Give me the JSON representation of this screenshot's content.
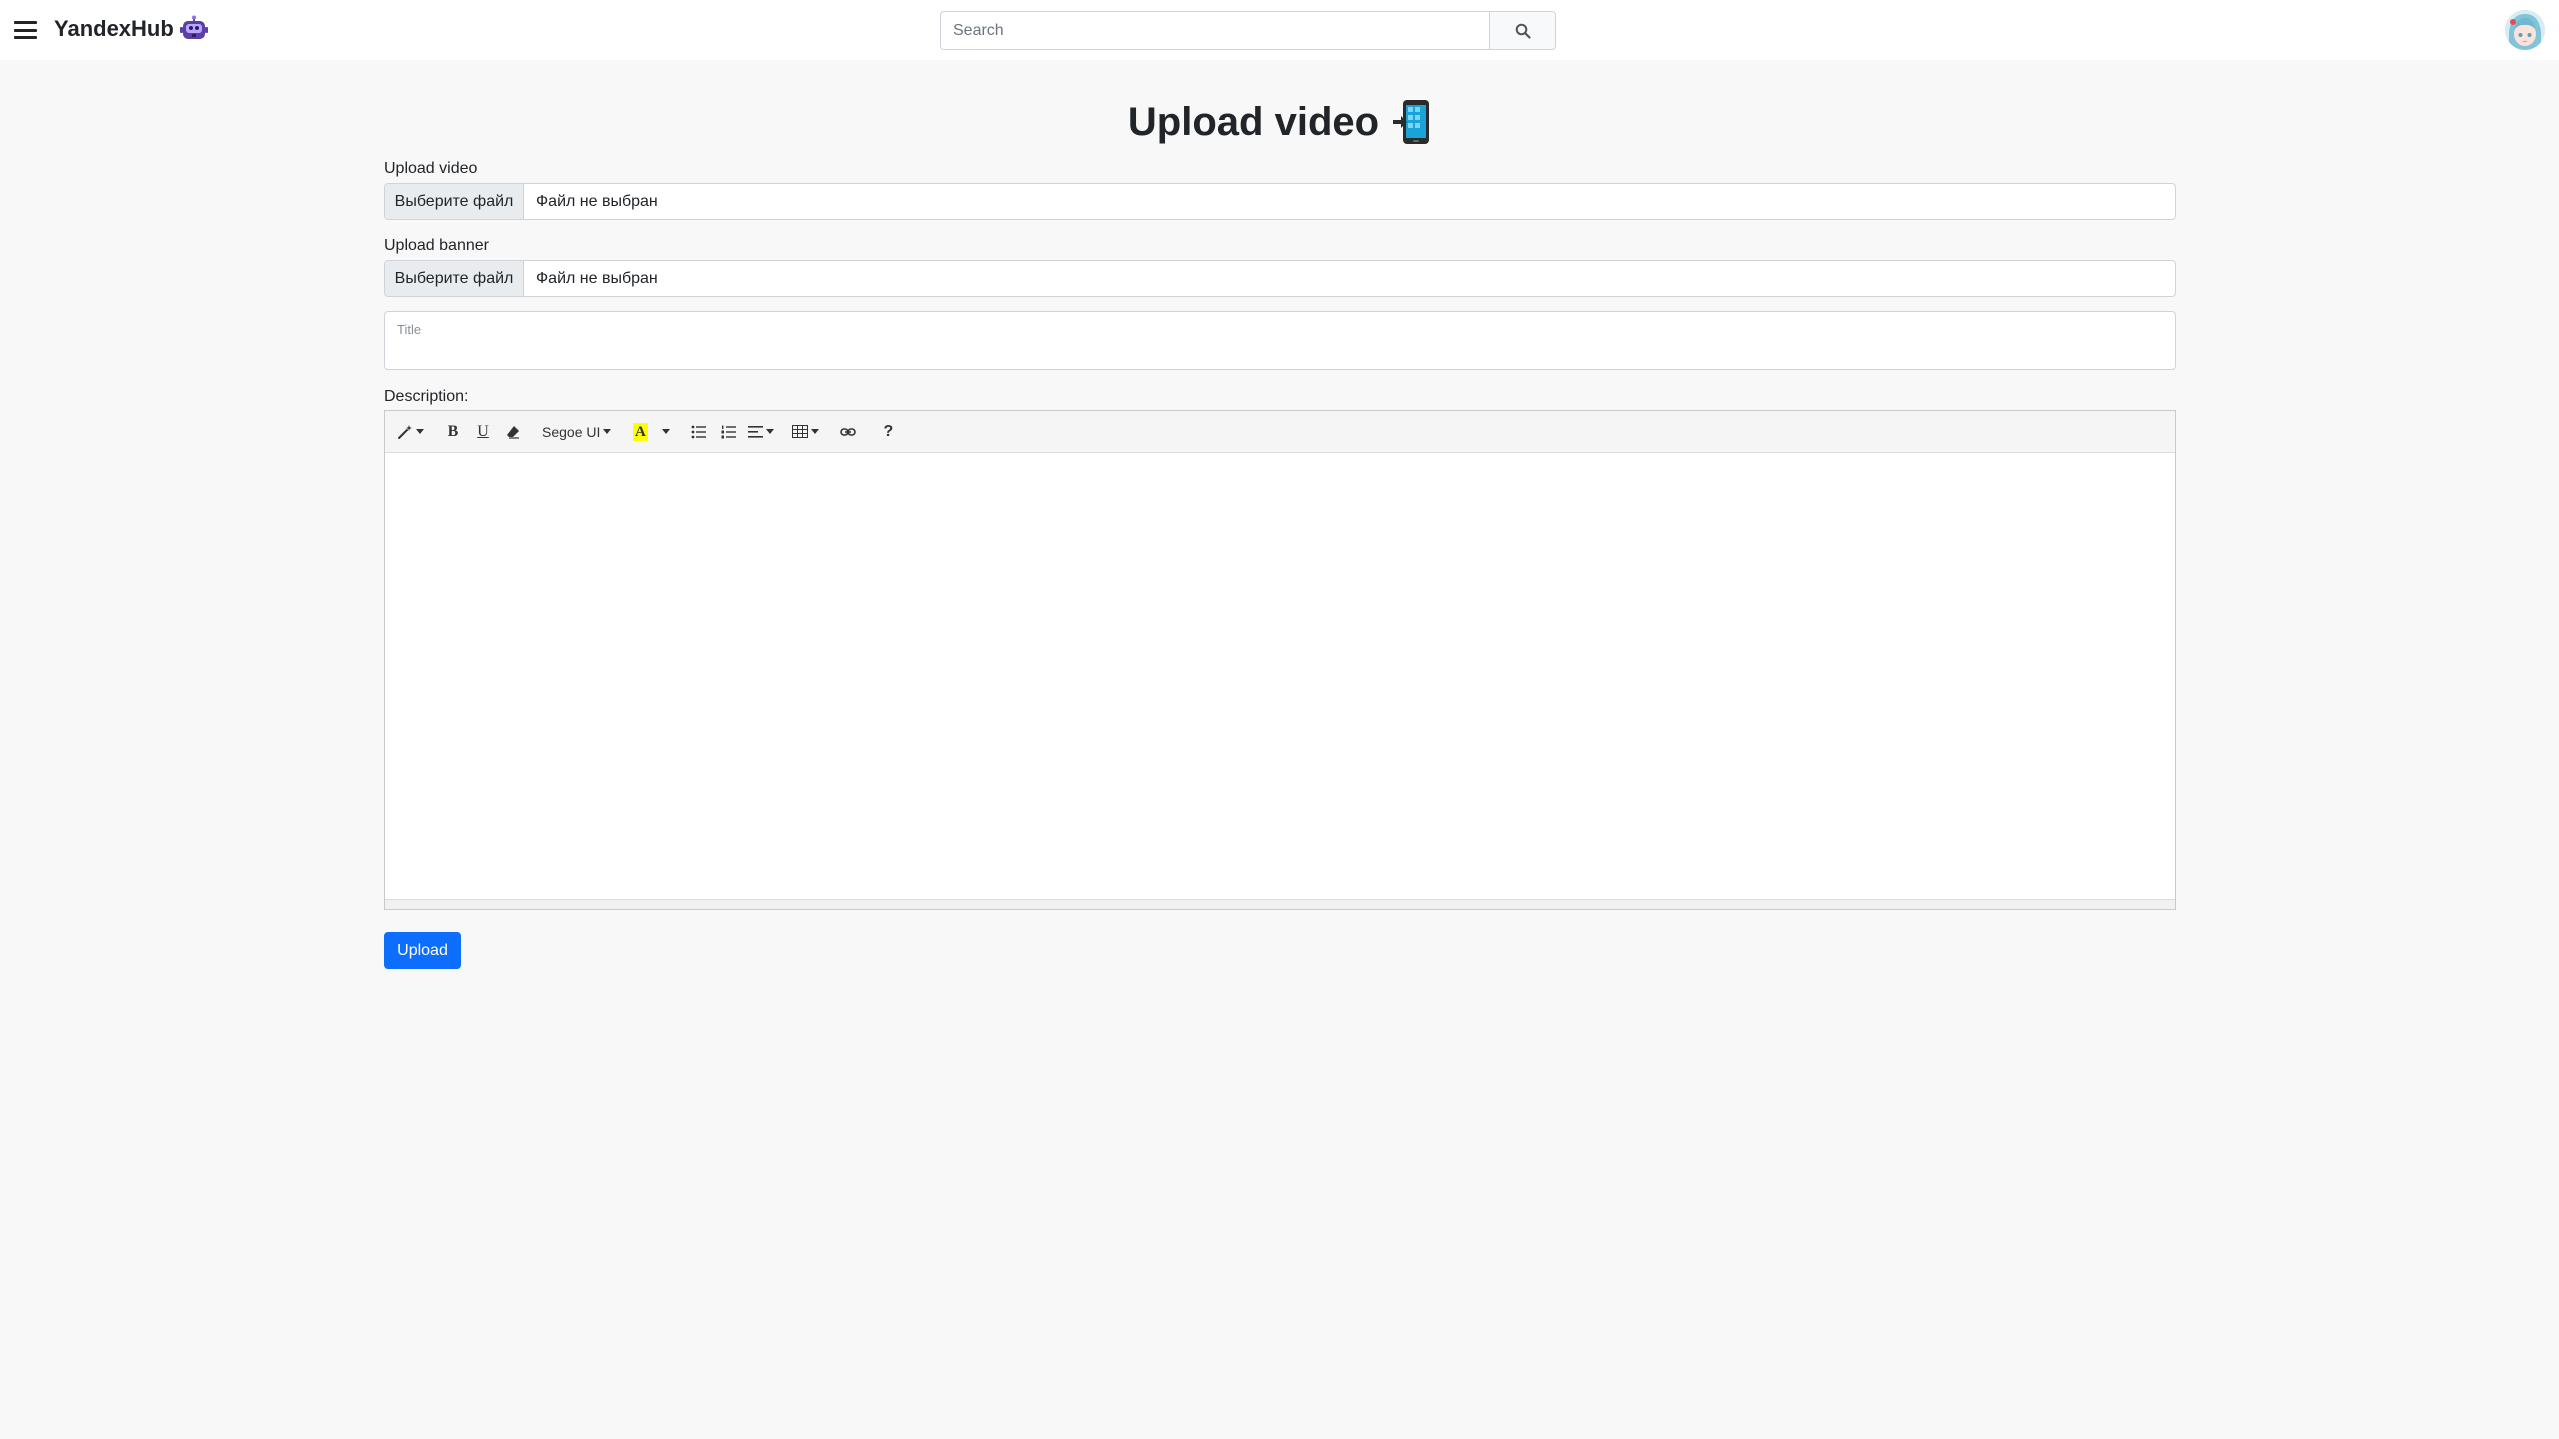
{
  "navbar": {
    "brand": "YandexHub",
    "search_placeholder": "Search"
  },
  "page": {
    "title": "Upload video"
  },
  "form": {
    "upload_video_label": "Upload video",
    "upload_banner_label": "Upload banner",
    "file_button_label": "Выберите файл",
    "file_status": "Файл не выбран",
    "title_label": "Title",
    "description_label": "Description:",
    "submit_label": "Upload"
  },
  "editor": {
    "font_name": "Segoe UI",
    "help_label": "?",
    "highlight_color": "#ffff00"
  },
  "colors": {
    "accent": "#0d6efd",
    "background": "#f8f8f8"
  }
}
